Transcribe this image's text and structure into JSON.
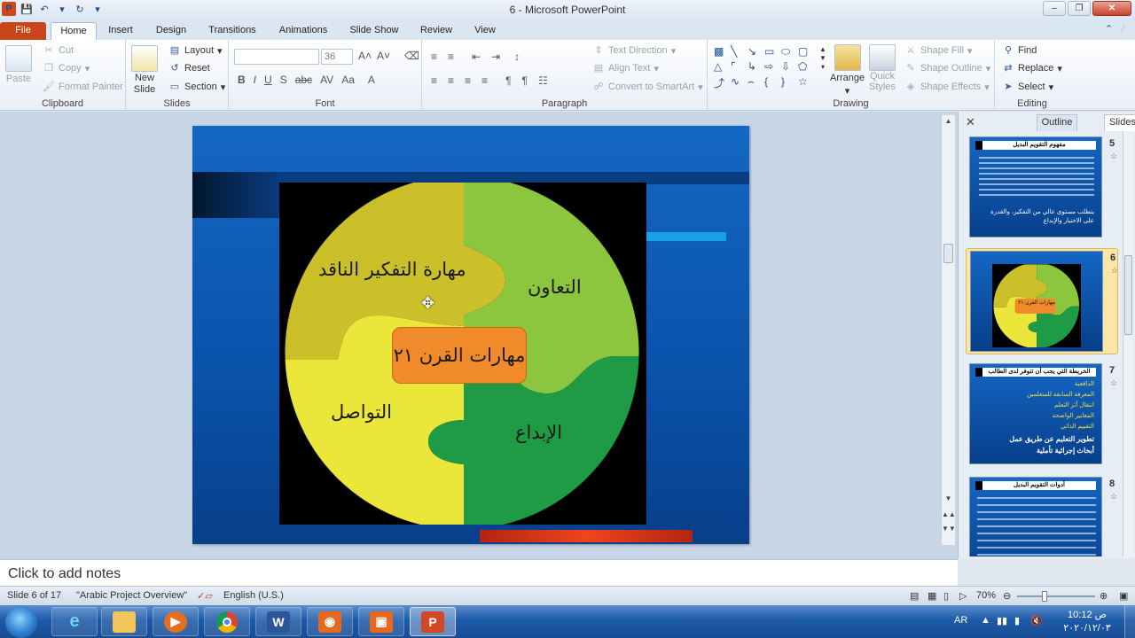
{
  "window": {
    "title": "6  -  Microsoft PowerPoint"
  },
  "qat": {
    "undo_icon": "undo-icon",
    "redo_icon": "redo-icon",
    "save_icon": "save-icon"
  },
  "tabs": [
    "File",
    "Home",
    "Insert",
    "Design",
    "Transitions",
    "Animations",
    "Slide Show",
    "Review",
    "View"
  ],
  "ribbon": {
    "clipboard": {
      "label": "Clipboard",
      "paste": "Paste",
      "cut": "Cut",
      "copy": "Copy",
      "format_painter": "Format Painter"
    },
    "slides": {
      "label": "Slides",
      "new_slide_1": "New",
      "new_slide_2": "Slide",
      "layout": "Layout",
      "reset": "Reset",
      "section": "Section"
    },
    "font": {
      "label": "Font",
      "font_name": "",
      "font_size": "36"
    },
    "paragraph": {
      "label": "Paragraph",
      "text_direction": "Text Direction",
      "align_text": "Align Text",
      "convert_smartart": "Convert to SmartArt"
    },
    "drawing": {
      "label": "Drawing",
      "arrange": "Arrange",
      "quick_styles_1": "Quick",
      "quick_styles_2": "Styles",
      "shape_fill": "Shape Fill",
      "shape_outline": "Shape Outline",
      "shape_effects": "Shape Effects"
    },
    "editing": {
      "label": "Editing",
      "find": "Find",
      "replace": "Replace",
      "select": "Select"
    }
  },
  "slide": {
    "pieces": {
      "critical_thinking": "مهارة التفكير الناقد",
      "cooperation": "التعاون",
      "communication": "التواصل",
      "creativity": "الإبداع",
      "center": "مهارات القرن ٢١"
    }
  },
  "panel": {
    "tab_outline": "Outline",
    "tab_slides": "Slides",
    "thumbnails": [
      {
        "num": "5",
        "title": "مفهوم التقويم البديل",
        "text_1": "يتطلب مستوى عالي من التفكير، والقدرة",
        "text_2": "على الاختيار والإبداع"
      },
      {
        "num": "6",
        "center": "مهارات القرن ٢١"
      },
      {
        "num": "7",
        "title": "الخريطة التي يجب أن تتوفر لدى الطالب",
        "lines": [
          "الدافعية",
          "المعرفة السابقة للمتعلمين",
          "انتقال أثر التعلم",
          "المعايير الواضحة",
          "التقييم الذاتي"
        ],
        "line_6": "تطوير التعليم عن طريق عمل",
        "line_7": "أبحاث إجرائية تأملية"
      },
      {
        "num": "8",
        "title": "أدوات التقويم البديل"
      }
    ]
  },
  "notes": {
    "placeholder": "Click to add notes"
  },
  "status": {
    "slide_of": "Slide 6 of 17",
    "theme": "\"Arabic Project Overview\"",
    "language": "English (U.S.)",
    "zoom": "70%"
  },
  "taskbar": {
    "lang": "AR",
    "time": "10:12 ص",
    "date": "٢٠٢٠/١٢/٠٣"
  },
  "colors": {
    "file_tab": "#c9461b",
    "slide_bg": "#0a52aa",
    "puzzle_olive": "#cbbf2a",
    "puzzle_lightgreen": "#8cc63f",
    "puzzle_yellow": "#ebe63a",
    "puzzle_green": "#1f9a45",
    "center_orange": "#f08a2a"
  }
}
